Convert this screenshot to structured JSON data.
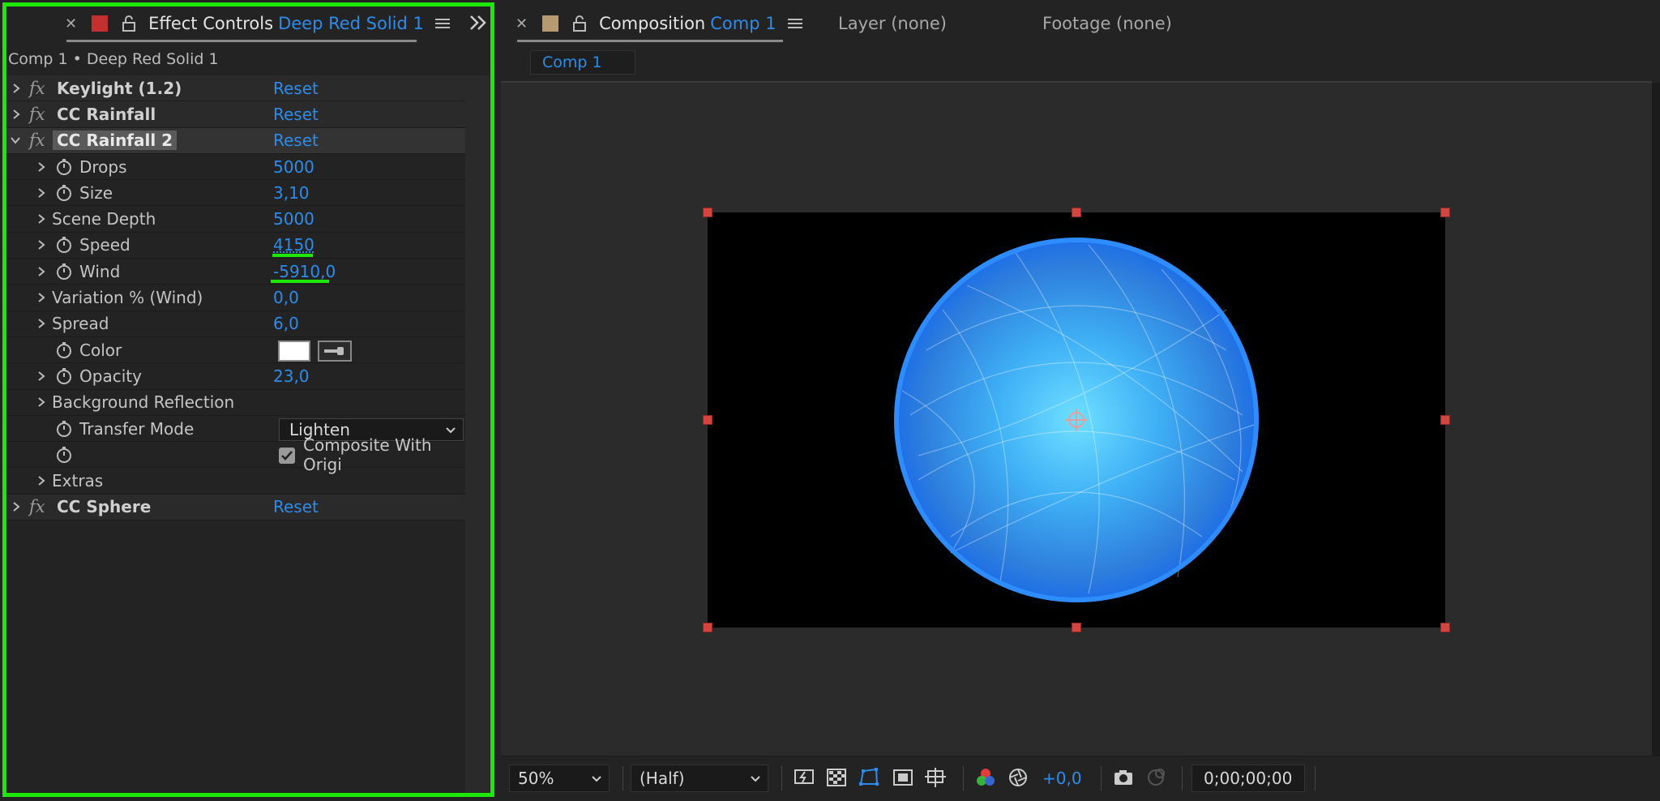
{
  "left_panel": {
    "tab_title": "Effect Controls",
    "tab_subtitle": "Deep Red Solid 1",
    "subheader": "Comp 1 • Deep Red Solid 1",
    "effects": [
      {
        "name": "Keylight (1.2)",
        "reset": "Reset"
      },
      {
        "name": "CC Rainfall",
        "reset": "Reset"
      },
      {
        "name": "CC Rainfall 2",
        "reset": "Reset"
      },
      {
        "name": "CC Sphere",
        "reset": "Reset"
      }
    ],
    "props": {
      "drops": {
        "label": "Drops",
        "value": "5000"
      },
      "size": {
        "label": "Size",
        "value": "3,10"
      },
      "scene_depth": {
        "label": "Scene Depth",
        "value": "5000"
      },
      "speed": {
        "label": "Speed",
        "value": "4150"
      },
      "wind": {
        "label": "Wind",
        "value": "-5910,0"
      },
      "variation_wind": {
        "label": "Variation % (Wind)",
        "value": "0,0"
      },
      "spread": {
        "label": "Spread",
        "value": "6,0"
      },
      "color": {
        "label": "Color"
      },
      "opacity": {
        "label": "Opacity",
        "value": "23,0"
      },
      "background_reflection": {
        "label": "Background Reflection"
      },
      "transfer_mode": {
        "label": "Transfer Mode",
        "value": "Lighten"
      },
      "composite": {
        "label": "Composite With Origi",
        "checked": true
      },
      "extras": {
        "label": "Extras"
      }
    }
  },
  "right_panel": {
    "tab_title": "Composition",
    "tab_subtitle": "Comp 1",
    "layer_tab": "Layer (none)",
    "footage_tab": "Footage (none)",
    "comp_subtab": "Comp 1",
    "bottom": {
      "zoom": "50%",
      "resolution": "(Half)",
      "exposure": "+0,0",
      "timecode": "0;00;00;00"
    }
  },
  "colors": {
    "highlight_green": "#1ee80a",
    "accent_blue": "#2d8ceb",
    "handle_red": "#d4453f",
    "swatch_red": "#c42f2f",
    "swatch_tan": "#b59a72"
  }
}
